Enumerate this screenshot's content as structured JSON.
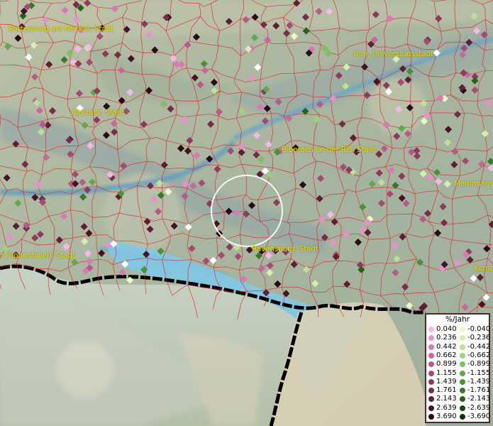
{
  "map": {
    "city_labels": [
      {
        "id": "rottenburg",
        "text": "Rottenburg am Neckar, Stadt"
      },
      {
        "id": "ulm",
        "text": "Ulm, Universitätsstadt"
      },
      {
        "id": "albstadt",
        "text": "Albstadt, Stadt"
      },
      {
        "id": "biberach",
        "text": "Biberach an der Riß, Stadt"
      },
      {
        "id": "memmingen",
        "text": "Memminge"
      },
      {
        "id": "ravensburg",
        "text": "Ravensburg, Stadt"
      },
      {
        "id": "singen",
        "text": "n (Hohentwiel), Stadt"
      },
      {
        "id": "kempten",
        "text": "Kemp"
      }
    ],
    "colors": {
      "border_lines": "#e02020",
      "state_border": "#000000",
      "lake": "#7ec8ea",
      "highlight_circle": "#ffffff"
    }
  },
  "legend": {
    "title": "%/Jahr",
    "positive": [
      {
        "label": "0.040",
        "color": "#f6b8ea"
      },
      {
        "label": "0.236",
        "color": "#e890cc"
      },
      {
        "label": "0.442",
        "color": "#d878b4"
      },
      {
        "label": "0.662",
        "color": "#c8679c"
      },
      {
        "label": "0.899",
        "color": "#b65a88"
      },
      {
        "label": "1.155",
        "color": "#a44b74"
      },
      {
        "label": "1.439",
        "color": "#8e3a5c"
      },
      {
        "label": "1.761",
        "color": "#772c48"
      },
      {
        "label": "2.143",
        "color": "#5e1f34"
      },
      {
        "label": "2.639",
        "color": "#441424"
      },
      {
        "label": "3.690",
        "color": "#2a0a14"
      }
    ],
    "negative": [
      {
        "label": "-0.040",
        "color": "#eef7c8"
      },
      {
        "label": "-0.236",
        "color": "#d8eeb0"
      },
      {
        "label": "-0.442",
        "color": "#bde096"
      },
      {
        "label": "-0.662",
        "color": "#9fd07c"
      },
      {
        "label": "-0.899",
        "color": "#7fbe62"
      },
      {
        "label": "-1.155",
        "color": "#62a84a"
      },
      {
        "label": "-1.439",
        "color": "#4a9236"
      },
      {
        "label": "-1.761",
        "color": "#357a26"
      },
      {
        "label": "-2.143",
        "color": "#236218"
      },
      {
        "label": "-2.639",
        "color": "#154a0e"
      },
      {
        "label": "-3.690",
        "color": "#0a3206"
      }
    ]
  }
}
